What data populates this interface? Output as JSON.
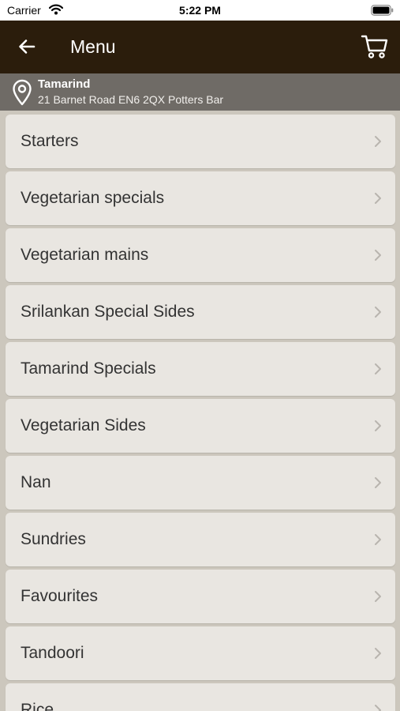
{
  "status_bar": {
    "carrier": "Carrier",
    "time": "5:22 PM"
  },
  "nav": {
    "title": "Menu"
  },
  "location": {
    "name": "Tamarind",
    "address": "21 Barnet Road EN6 2QX Potters Bar"
  },
  "menu": {
    "items": [
      {
        "label": "Starters"
      },
      {
        "label": "Vegetarian specials"
      },
      {
        "label": "Vegetarian mains"
      },
      {
        "label": "Srilankan Special Sides"
      },
      {
        "label": "Tamarind Specials"
      },
      {
        "label": "Vegetarian Sides"
      },
      {
        "label": "Nan"
      },
      {
        "label": "Sundries"
      },
      {
        "label": "Favourites"
      },
      {
        "label": "Tandoori"
      },
      {
        "label": "Rice"
      }
    ]
  },
  "colors": {
    "nav_background": "#2b1d0c",
    "location_background": "#6f6b66",
    "list_background": "#ccc7bd",
    "item_background": "#e9e6e1"
  },
  "icons": [
    "wifi-icon",
    "battery-icon",
    "back-arrow-icon",
    "cart-icon",
    "location-pin-icon",
    "chevron-right-icon"
  ]
}
